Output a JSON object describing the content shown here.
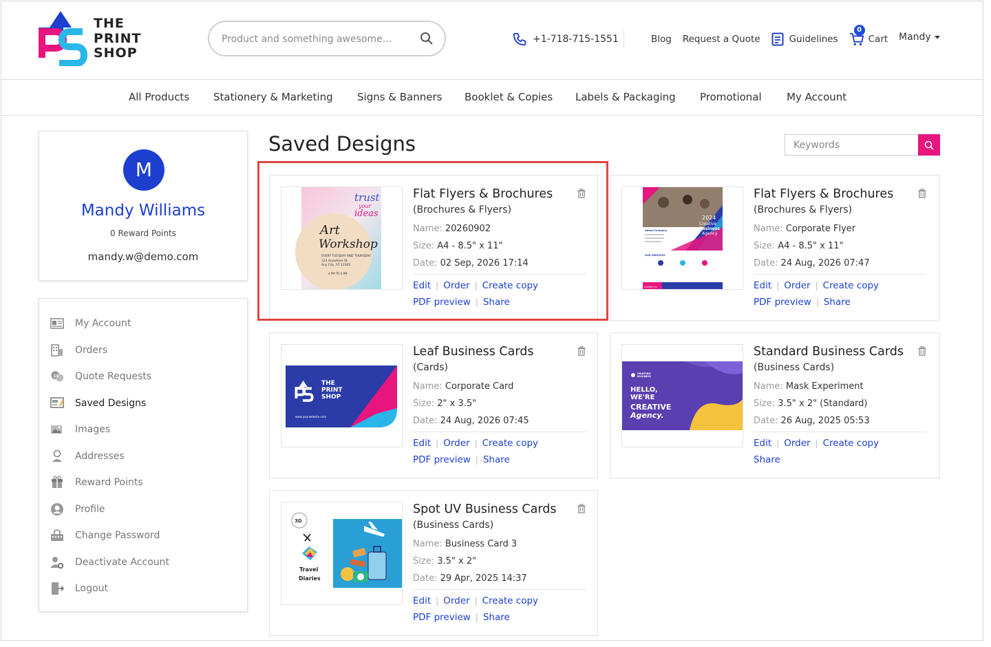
{
  "brand": {
    "logo_lines": [
      "THE",
      "PRINT",
      "SHOP"
    ],
    "colors": {
      "primary": "#1c3fcf",
      "accent": "#e8157f",
      "highlight": "#e04444",
      "cyan": "#29b6e8"
    }
  },
  "header": {
    "search_placeholder": "Product and something awesome...",
    "phone": "+1-718-715-1551",
    "links": [
      "Blog",
      "Request a Quote",
      "Guidelines"
    ],
    "cart_label": "Cart",
    "cart_count": "0",
    "user_name": "Mandy"
  },
  "nav": [
    "All Products",
    "Stationery & Marketing",
    "Signs & Banners",
    "Booklet & Copies",
    "Labels & Packaging",
    "Promotional",
    "My Account"
  ],
  "profile": {
    "initial": "M",
    "name": "Mandy Williams",
    "reward_points": "0 Reward Points",
    "email": "mandy.w@demo.com"
  },
  "sidebar": [
    {
      "label": "My Account",
      "icon": "id-card-icon"
    },
    {
      "label": "Orders",
      "icon": "building-icon"
    },
    {
      "label": "Quote Requests",
      "icon": "chat-bubbles-icon"
    },
    {
      "label": "Saved Designs",
      "icon": "design-board-icon",
      "active": true
    },
    {
      "label": "Images",
      "icon": "images-icon"
    },
    {
      "label": "Addresses",
      "icon": "person-pin-icon"
    },
    {
      "label": "Reward Points",
      "icon": "gift-icon"
    },
    {
      "label": "Profile",
      "icon": "user-circle-icon"
    },
    {
      "label": "Change Password",
      "icon": "lock-keyboard-icon"
    },
    {
      "label": "Deactivate Account",
      "icon": "user-gear-icon"
    },
    {
      "label": "Logout",
      "icon": "door-exit-icon"
    }
  ],
  "main": {
    "title": "Saved Designs",
    "keywords_placeholder": "Keywords",
    "field_labels": {
      "name": "Name:",
      "size": "Size:",
      "date": "Date:"
    },
    "action_labels": {
      "edit": "Edit",
      "order": "Order",
      "copy": "Create copy",
      "pdf": "PDF preview",
      "share": "Share"
    },
    "designs": [
      {
        "title": "Flat Flyers & Brochures",
        "category": "(Brochures & Flyers)",
        "name": "20260902",
        "size": "A4 - 8.5\" x 11\"",
        "date": "02 Sep, 2026 17:14",
        "thumb_text": {
          "l1": "trust",
          "l2": "your",
          "l3": "ideas",
          "l4": "Art",
          "l5": "Workshop",
          "l6": "EVERY TUESDAY AND THURSDAY",
          "l7": "123 Anywhere St.",
          "l8": "Any City, ST 12345",
          "l9": "4 PM TO 6 PM"
        }
      },
      {
        "title": "Flat Flyers & Brochures",
        "category": "(Brochures & Flyers)",
        "name": "Corporate Flyer",
        "size": "A4 - 8.5\" x 11\"",
        "date": "24 Aug, 2026 07:47",
        "thumb_text": {
          "l1": "2024",
          "l2": "Creative",
          "l3": "Business",
          "l4": "Agency",
          "l5": "About Company",
          "l6": "OUR SERVICES",
          "l7": "Contact Us"
        }
      },
      {
        "title": "Leaf Business Cards",
        "category": "(Cards)",
        "name": "Corporate Card",
        "size": "2\" x 3.5\"",
        "date": "24 Aug, 2026 07:45",
        "thumb_text": {
          "l1": "THE",
          "l2": "PRINT",
          "l3": "SHOP",
          "l4": "www.yourwebsite.com"
        }
      },
      {
        "title": "Standard Business Cards",
        "category": "(Business Cards)",
        "name": "Mask Experiment",
        "size": "3.5\" x 2\" (Standard)",
        "date": "26 Aug, 2025 05:53",
        "thumb_text": {
          "l1": "PRINTING",
          "l2": "BUSINESS",
          "l3": "HELLO,",
          "l4": "WE'RE",
          "l5": "CREATIVE",
          "l6": "Agency."
        }
      },
      {
        "title": "Spot UV Business Cards",
        "category": "(Business Cards)",
        "name": "Business Card 3",
        "size": "3.5\" x 2\"",
        "date": "29 Apr, 2025 14:37",
        "thumb_text": {
          "l1": "3D",
          "l2": "Travel",
          "l3": "Diaries"
        }
      }
    ]
  }
}
